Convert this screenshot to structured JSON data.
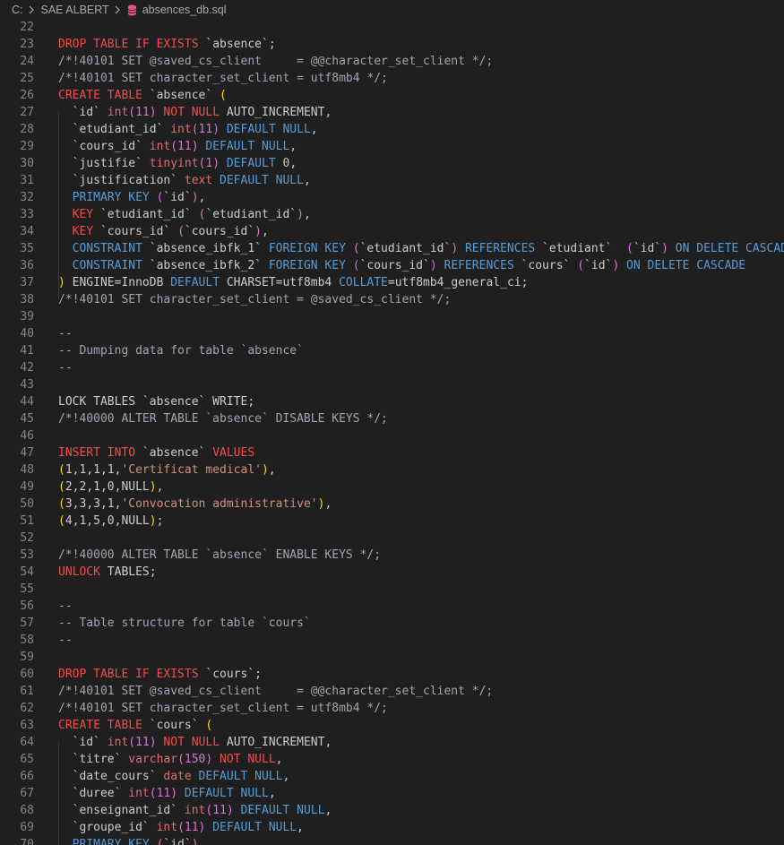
{
  "breadcrumb": {
    "drive": "C:",
    "folder": "SAE ALBERT",
    "file": "absences_db.sql",
    "icons": [
      "chevron-right-icon",
      "database-icon"
    ]
  },
  "colors": {
    "keyword": "#f14c4c",
    "type": "#e06c75",
    "builtin": "#569cd6",
    "comment": "#9da5b4",
    "string": "#ce9178",
    "number": "#b5cea8",
    "bracket1": "#ffd700",
    "bracket2": "#da70d6",
    "bracket3": "#179fff",
    "text": "#cccccc",
    "lineNumber": "#858585"
  },
  "editor": {
    "first_line": 22,
    "lines": [
      [],
      [
        [
          "DROP TABLE IF EXISTS",
          "keyword"
        ],
        [
          " `absence`;",
          "text"
        ]
      ],
      [
        [
          "/*!40101 SET @saved_cs_client     = @@character_set_client */;",
          "comment"
        ]
      ],
      [
        [
          "/*!40101 SET character_set_client = utf8mb4 */;",
          "comment"
        ]
      ],
      [
        [
          "CREATE TABLE",
          "keyword"
        ],
        [
          " `absence` ",
          "text"
        ],
        [
          "(",
          "bracket1"
        ]
      ],
      [
        [
          "  `id` ",
          "text"
        ],
        [
          "int",
          "type"
        ],
        [
          "(11)",
          "bracket2"
        ],
        [
          " NOT NULL",
          "keyword"
        ],
        [
          " AUTO_INCREMENT,",
          "text"
        ]
      ],
      [
        [
          "  `etudiant_id` ",
          "text"
        ],
        [
          "int",
          "type"
        ],
        [
          "(11)",
          "bracket2"
        ],
        [
          " DEFAULT NULL",
          "builtin"
        ],
        [
          ",",
          "text"
        ]
      ],
      [
        [
          "  `cours_id` ",
          "text"
        ],
        [
          "int",
          "type"
        ],
        [
          "(11)",
          "bracket2"
        ],
        [
          " DEFAULT NULL",
          "builtin"
        ],
        [
          ",",
          "text"
        ]
      ],
      [
        [
          "  `justifie` ",
          "text"
        ],
        [
          "tinyint",
          "type"
        ],
        [
          "(1)",
          "bracket2"
        ],
        [
          " DEFAULT ",
          "builtin"
        ],
        [
          "0",
          "number"
        ],
        [
          ",",
          "text"
        ]
      ],
      [
        [
          "  `justification` ",
          "text"
        ],
        [
          "text",
          "type"
        ],
        [
          " DEFAULT NULL",
          "builtin"
        ],
        [
          ",",
          "text"
        ]
      ],
      [
        [
          "  PRIMARY KEY ",
          "builtin"
        ],
        [
          "(",
          "bracket2"
        ],
        [
          "`id`",
          "text"
        ],
        [
          ")",
          "bracket2"
        ],
        [
          ",",
          "text"
        ]
      ],
      [
        [
          "  KEY",
          "keyword"
        ],
        [
          " `etudiant_id` ",
          "text"
        ],
        [
          "(",
          "bracket2"
        ],
        [
          "`etudiant_id`",
          "text"
        ],
        [
          ")",
          "bracket2"
        ],
        [
          ",",
          "text"
        ]
      ],
      [
        [
          "  KEY",
          "keyword"
        ],
        [
          " `cours_id` ",
          "text"
        ],
        [
          "(",
          "bracket2"
        ],
        [
          "`cours_id`",
          "text"
        ],
        [
          ")",
          "bracket2"
        ],
        [
          ",",
          "text"
        ]
      ],
      [
        [
          "  CONSTRAINT",
          "builtin"
        ],
        [
          " `absence_ibfk_1` ",
          "text"
        ],
        [
          "FOREIGN KEY ",
          "builtin"
        ],
        [
          "(",
          "bracket2"
        ],
        [
          "`etudiant_id`",
          "text"
        ],
        [
          ")",
          "bracket2"
        ],
        [
          " REFERENCES",
          "builtin"
        ],
        [
          " `etudiant` ",
          "text"
        ],
        [
          " (",
          "bracket2"
        ],
        [
          "`id`",
          "text"
        ],
        [
          ")",
          "bracket2"
        ],
        [
          " ON DELETE CASCADE,",
          "builtin"
        ]
      ],
      [
        [
          "  CONSTRAINT",
          "builtin"
        ],
        [
          " `absence_ibfk_2` ",
          "text"
        ],
        [
          "FOREIGN KEY ",
          "builtin"
        ],
        [
          "(",
          "bracket2"
        ],
        [
          "`cours_id`",
          "text"
        ],
        [
          ")",
          "bracket2"
        ],
        [
          " REFERENCES",
          "builtin"
        ],
        [
          " `cours` ",
          "text"
        ],
        [
          "(",
          "bracket2"
        ],
        [
          "`id`",
          "text"
        ],
        [
          ")",
          "bracket2"
        ],
        [
          " ON DELETE CASCADE",
          "builtin"
        ]
      ],
      [
        [
          ")",
          "bracket1"
        ],
        [
          " ENGINE=InnoDB ",
          "text"
        ],
        [
          "DEFAULT",
          "builtin"
        ],
        [
          " CHARSET=utf8mb4 ",
          "text"
        ],
        [
          "COLLATE",
          "builtin"
        ],
        [
          "=utf8mb4_general_ci;",
          "text"
        ]
      ],
      [
        [
          "/*!40101 SET character_set_client = @saved_cs_client */;",
          "comment"
        ]
      ],
      [],
      [
        [
          "--",
          "comment"
        ]
      ],
      [
        [
          "-- Dumping data for table `absence`",
          "comment"
        ]
      ],
      [
        [
          "--",
          "comment"
        ]
      ],
      [],
      [
        [
          "LOCK TABLES `absence` WRITE;",
          "text"
        ]
      ],
      [
        [
          "/*!40000 ALTER TABLE `absence` DISABLE KEYS */;",
          "comment"
        ]
      ],
      [],
      [
        [
          "INSERT INTO",
          "keyword"
        ],
        [
          " `absence` ",
          "text"
        ],
        [
          "VALUES",
          "keyword"
        ]
      ],
      [
        [
          "(",
          "bracket1"
        ],
        [
          "1,1,1,1,",
          "text"
        ],
        [
          "'Certificat medical'",
          "string"
        ],
        [
          ")",
          "bracket1"
        ],
        [
          ",",
          "text"
        ]
      ],
      [
        [
          "(",
          "bracket1"
        ],
        [
          "2,2,1,0,NULL",
          "text"
        ],
        [
          ")",
          "bracket1"
        ],
        [
          ",",
          "text"
        ]
      ],
      [
        [
          "(",
          "bracket1"
        ],
        [
          "3,3,3,1,",
          "text"
        ],
        [
          "'Convocation administrative'",
          "string"
        ],
        [
          ")",
          "bracket1"
        ],
        [
          ",",
          "text"
        ]
      ],
      [
        [
          "(",
          "bracket1"
        ],
        [
          "4,1,5,0,NULL",
          "text"
        ],
        [
          ")",
          "bracket1"
        ],
        [
          ";",
          "text"
        ]
      ],
      [],
      [
        [
          "/*!40000 ALTER TABLE `absence` ENABLE KEYS */;",
          "comment"
        ]
      ],
      [
        [
          "UNLOCK",
          "keyword"
        ],
        [
          " TABLES;",
          "text"
        ]
      ],
      [],
      [
        [
          "--",
          "comment"
        ]
      ],
      [
        [
          "-- Table structure for table `cours`",
          "comment"
        ]
      ],
      [
        [
          "--",
          "comment"
        ]
      ],
      [],
      [
        [
          "DROP TABLE IF EXISTS",
          "keyword"
        ],
        [
          " `cours`;",
          "text"
        ]
      ],
      [
        [
          "/*!40101 SET @saved_cs_client     = @@character_set_client */;",
          "comment"
        ]
      ],
      [
        [
          "/*!40101 SET character_set_client = utf8mb4 */;",
          "comment"
        ]
      ],
      [
        [
          "CREATE TABLE",
          "keyword"
        ],
        [
          " `cours` ",
          "text"
        ],
        [
          "(",
          "bracket1"
        ]
      ],
      [
        [
          "  `id` ",
          "text"
        ],
        [
          "int",
          "type"
        ],
        [
          "(11)",
          "bracket2"
        ],
        [
          " NOT NULL",
          "keyword"
        ],
        [
          " AUTO_INCREMENT,",
          "text"
        ]
      ],
      [
        [
          "  `titre` ",
          "text"
        ],
        [
          "varchar",
          "type"
        ],
        [
          "(150)",
          "bracket2"
        ],
        [
          " NOT NULL",
          "keyword"
        ],
        [
          ",",
          "text"
        ]
      ],
      [
        [
          "  `date_cours` ",
          "text"
        ],
        [
          "date",
          "type"
        ],
        [
          " DEFAULT NULL",
          "builtin"
        ],
        [
          ",",
          "text"
        ]
      ],
      [
        [
          "  `duree` ",
          "text"
        ],
        [
          "int",
          "type"
        ],
        [
          "(11)",
          "bracket2"
        ],
        [
          " DEFAULT NULL",
          "builtin"
        ],
        [
          ",",
          "text"
        ]
      ],
      [
        [
          "  `enseignant_id` ",
          "text"
        ],
        [
          "int",
          "type"
        ],
        [
          "(11)",
          "bracket2"
        ],
        [
          " DEFAULT NULL",
          "builtin"
        ],
        [
          ",",
          "text"
        ]
      ],
      [
        [
          "  `groupe_id` ",
          "text"
        ],
        [
          "int",
          "type"
        ],
        [
          "(11)",
          "bracket2"
        ],
        [
          " DEFAULT NULL",
          "builtin"
        ],
        [
          ",",
          "text"
        ]
      ],
      [
        [
          "  PRIMARY KEY ",
          "builtin"
        ],
        [
          "(",
          "bracket2"
        ],
        [
          "`id`",
          "text"
        ],
        [
          ")",
          "bracket2"
        ],
        [
          ",",
          "text"
        ]
      ]
    ]
  }
}
